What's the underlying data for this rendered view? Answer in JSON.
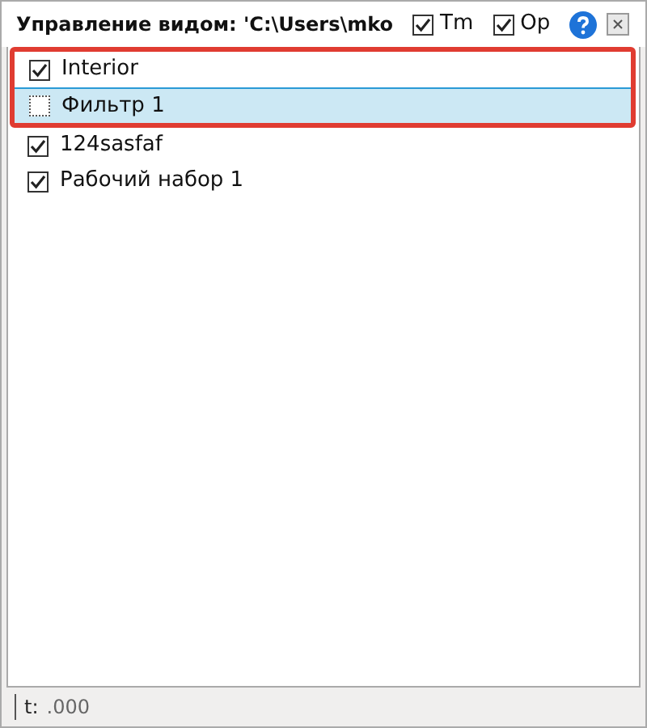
{
  "window": {
    "title": "Управление видом: 'C:\\Users\\mko"
  },
  "toggles": [
    {
      "label": "Tm",
      "checked": true
    },
    {
      "label": "Op",
      "checked": true
    }
  ],
  "items": [
    {
      "label": "Interior",
      "checked": true,
      "selected": false,
      "highlighted": true
    },
    {
      "label": "Фильтр 1",
      "checked": false,
      "selected": true,
      "highlighted": true
    },
    {
      "label": "124sasfaf",
      "checked": true,
      "selected": false,
      "highlighted": false
    },
    {
      "label": "Рабочий набор 1",
      "checked": true,
      "selected": false,
      "highlighted": false
    }
  ],
  "status_bar": {
    "label": "t:",
    "value": ".000"
  }
}
